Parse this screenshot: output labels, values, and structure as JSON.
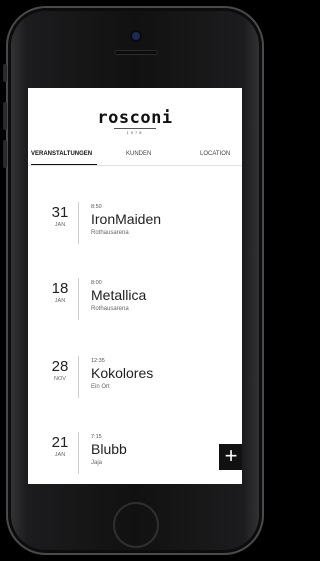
{
  "app": {
    "logo": "rosconi",
    "logo_sub": "1978"
  },
  "tabs": [
    {
      "label": "VERANSTALTUNGEN",
      "active": true
    },
    {
      "label": "KUNDEN",
      "active": false
    },
    {
      "label": "LOCATION",
      "active": false
    }
  ],
  "events": [
    {
      "day": "31",
      "month": "JAN",
      "time": "8:50",
      "title": "IronMaiden",
      "location": "Rothausarena"
    },
    {
      "day": "18",
      "month": "JAN",
      "time": "8:00",
      "title": "Metallica",
      "location": "Rothausarena"
    },
    {
      "day": "28",
      "month": "NOV",
      "time": "12:35",
      "title": "Kokolores",
      "location": "Ein Ort"
    },
    {
      "day": "21",
      "month": "JAN",
      "time": "7:15",
      "title": "Blubb",
      "location": "Jaja"
    }
  ],
  "fab": {
    "label": "+"
  }
}
